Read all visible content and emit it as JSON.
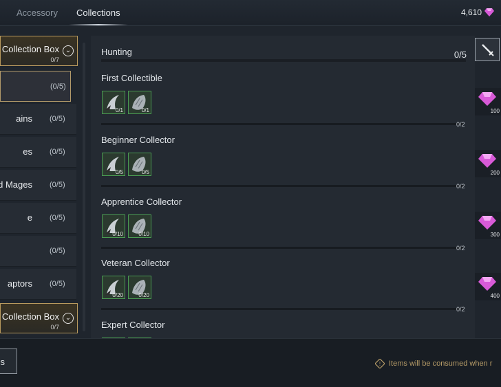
{
  "tabs": [
    {
      "label": "Accessory"
    },
    {
      "label": "Collections"
    }
  ],
  "currency": {
    "amount": "4,610",
    "icon": "gem-icon"
  },
  "sidebar": {
    "box_top": {
      "title": "Collection Box",
      "count": "0/7"
    },
    "items": [
      {
        "label": "",
        "count": "(0/5)"
      },
      {
        "label": "ains",
        "count": "(0/5)"
      },
      {
        "label": "es",
        "count": "(0/5)"
      },
      {
        "label": "d Mages",
        "count": "(0/5)"
      },
      {
        "label": "e",
        "count": "(0/5)"
      },
      {
        "label": "",
        "count": "(0/5)"
      },
      {
        "label": "aptors",
        "count": "(0/5)"
      }
    ],
    "box_bottom": {
      "title": "Collection Box",
      "count": "0/7"
    }
  },
  "category": {
    "title": "Hunting",
    "count": "0/5"
  },
  "entries": [
    {
      "name": "First Collectible",
      "slot1": "0/1",
      "slot2": "0/1",
      "progress": "0/2",
      "reward": "100"
    },
    {
      "name": "Beginner Collector",
      "slot1": "0/5",
      "slot2": "0/5",
      "progress": "0/2",
      "reward": "200"
    },
    {
      "name": "Apprentice Collector",
      "slot1": "0/10",
      "slot2": "0/10",
      "progress": "0/2",
      "reward": "300"
    },
    {
      "name": "Veteran Collector",
      "slot1": "0/20",
      "slot2": "0/20",
      "progress": "0/2",
      "reward": "400"
    },
    {
      "name": "Expert Collector"
    }
  ],
  "footer": {
    "button_label": "s",
    "notice": "Items will be consumed when r"
  },
  "colors": {
    "accent_gold": "#b99a5e",
    "slot_green": "#4a9b52",
    "gem": "#d85ad8"
  }
}
